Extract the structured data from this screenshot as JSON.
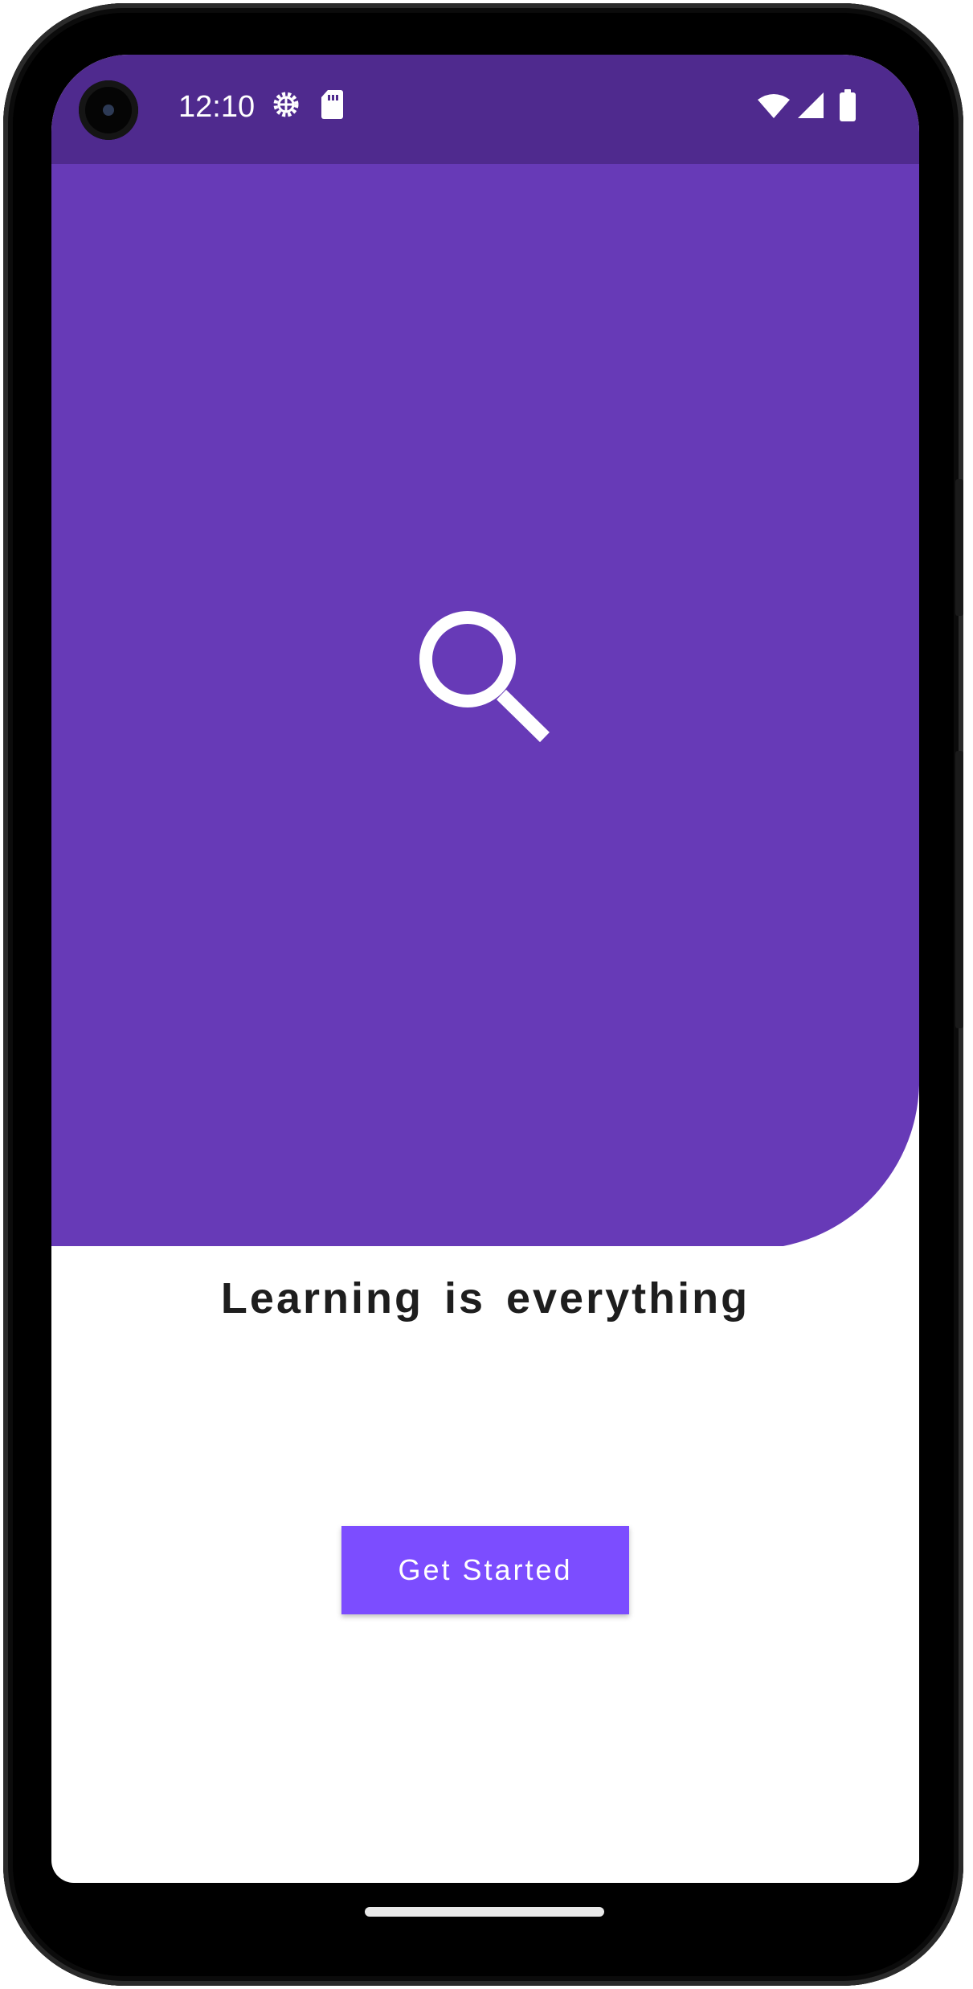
{
  "status_bar": {
    "time": "12:10",
    "icons": [
      "gear-notification-icon",
      "sd-card-icon",
      "wifi-icon",
      "cell-signal-icon",
      "battery-icon"
    ],
    "background_color": "#4f2a8e"
  },
  "hero": {
    "icon": "search-icon",
    "background_color": "#673ab7"
  },
  "headline": {
    "text": "Learning is everything"
  },
  "cta": {
    "label": "Get Started",
    "background_color": "#7c4dff"
  },
  "navigation": {
    "home_indicator": "home-gesture-bar"
  }
}
